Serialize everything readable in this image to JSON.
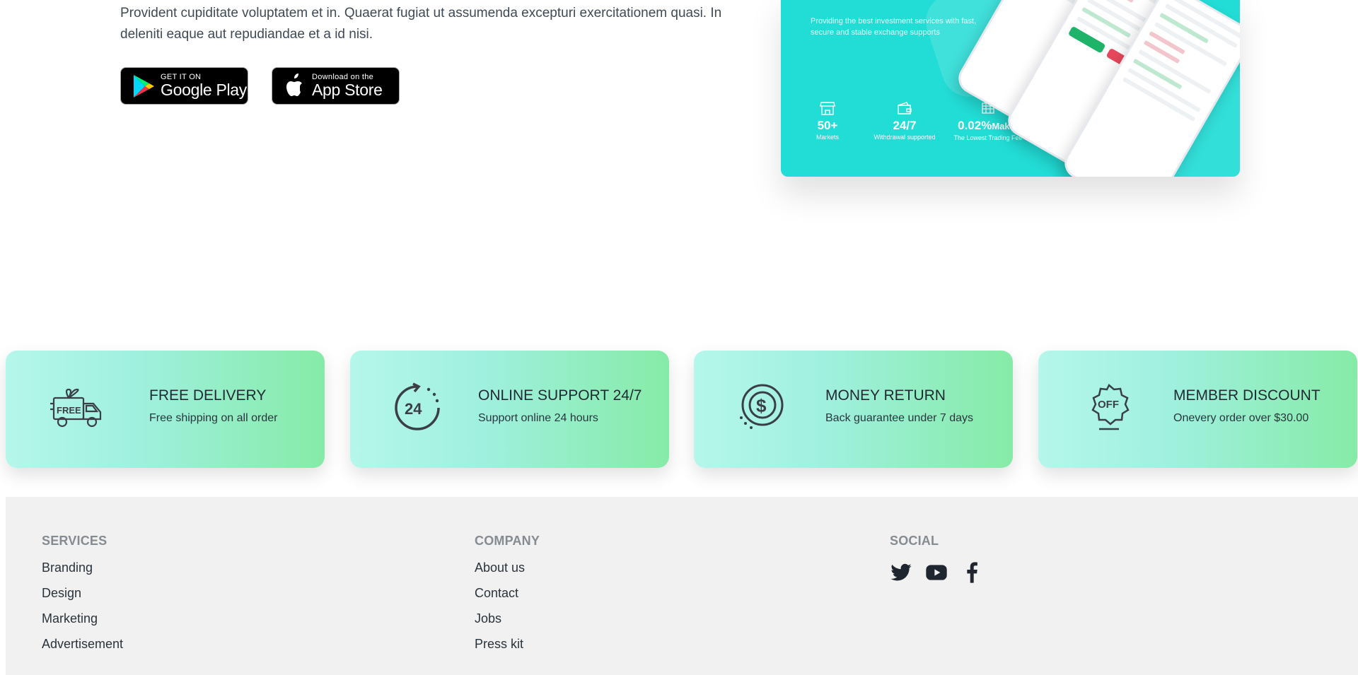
{
  "intro": {
    "text": "Provident cupiditate voluptatem et in. Quaerat fugiat ut assumenda excepturi exercitationem quasi. In deleniti eaque aut repudiandae et a id nisi."
  },
  "badges": {
    "google_play": {
      "small": "GET IT ON",
      "big": "Google Play"
    },
    "app_store": {
      "small": "Download on the",
      "big": "App Store"
    }
  },
  "promo": {
    "tagline": "Providing the best investment services with fast, secure and stable exchange supports",
    "stats": [
      {
        "value": "50+",
        "value_suffix": "",
        "label": "Markets",
        "icon": "store-icon"
      },
      {
        "value": "24/7",
        "value_suffix": "",
        "label": "Withdrawal supported",
        "icon": "wallet-icon"
      },
      {
        "value": "0.02%",
        "value_suffix": "Maker",
        "label": "The Lowest Trading Fee",
        "icon": "money-stack-icon"
      }
    ],
    "colors": {
      "background": "#22ddd6"
    }
  },
  "features": [
    {
      "title": "FREE DELIVERY",
      "desc": "Free shipping on all order",
      "icon": "delivery-truck-icon"
    },
    {
      "title": "ONLINE SUPPORT 24/7",
      "desc": "Support online 24 hours",
      "icon": "support-24-icon"
    },
    {
      "title": "MONEY RETURN",
      "desc": "Back guarantee under 7 days",
      "icon": "money-return-icon"
    },
    {
      "title": "MEMBER DISCOUNT",
      "desc": "Onevery order over $30.00",
      "icon": "discount-badge-icon"
    }
  ],
  "footer": {
    "services": {
      "heading": "SERVICES",
      "links": [
        "Branding",
        "Design",
        "Marketing",
        "Advertisement"
      ]
    },
    "company": {
      "heading": "COMPANY",
      "links": [
        "About us",
        "Contact",
        "Jobs",
        "Press kit"
      ]
    },
    "social": {
      "heading": "SOCIAL",
      "icons": [
        "twitter-icon",
        "youtube-icon",
        "facebook-icon"
      ]
    }
  }
}
